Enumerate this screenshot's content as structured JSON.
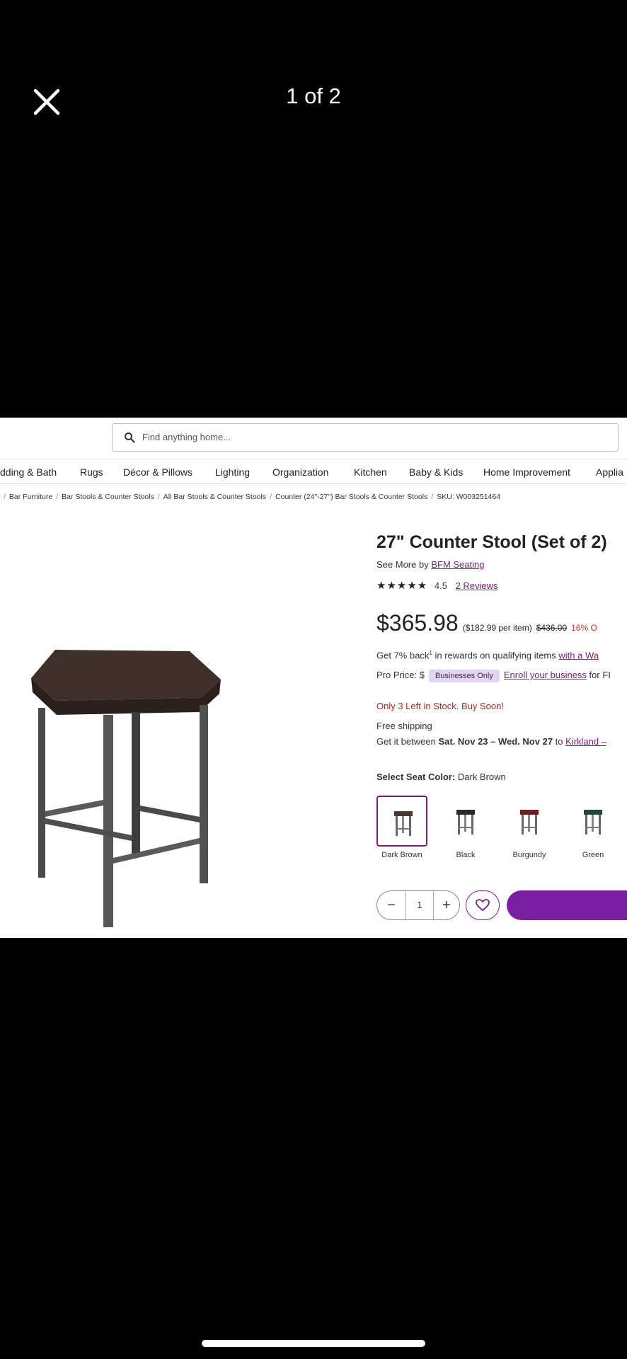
{
  "viewer": {
    "counter": "1 of 2"
  },
  "search": {
    "placeholder": "Find anything home..."
  },
  "nav": [
    "dding & Bath",
    "Rugs",
    "Décor & Pillows",
    "Lighting",
    "Organization",
    "Kitchen",
    "Baby & Kids",
    "Home Improvement",
    "Applia"
  ],
  "breadcrumb": [
    "Bar Furniture",
    "Bar Stools & Counter Stools",
    "All Bar Stools & Counter Stools",
    "Counter (24\"-27\") Bar Stools & Counter Stools",
    "SKU: W003251464"
  ],
  "product": {
    "title": "27\" Counter Stool (Set of 2)",
    "see_more_prefix": "See More by ",
    "brand": "BFM Seating",
    "rating": "4.5",
    "reviews": "2 Reviews",
    "price": "$365.98",
    "per_item": "($182.99 per item)",
    "old_price": "$436.00",
    "discount": "16% O",
    "rewards_pre": "Get 7% back",
    "rewards_sup": "1",
    "rewards_mid": " in rewards on qualifying items ",
    "rewards_link": "with a Wa",
    "pro_label": "Pro Price: $",
    "pro_badge": "Businesses Only",
    "pro_link": "Enroll your business",
    "pro_suffix": " for FI",
    "stock": "Only 3 Left in Stock. Buy Soon!",
    "shipping": "Free shipping",
    "delivery_pre": "Get it between ",
    "delivery_dates": "Sat. Nov 23 – Wed. Nov 27",
    "delivery_to": " to ",
    "delivery_link": "Kirkland –",
    "color_label": "Select Seat Color:",
    "color_value": " Dark Brown",
    "swatches": [
      {
        "label": "Dark Brown",
        "color": "#4a3a32"
      },
      {
        "label": "Black",
        "color": "#2a2a2a"
      },
      {
        "label": "Burgundy",
        "color": "#6b1f24"
      },
      {
        "label": "Green",
        "color": "#1f4a35"
      }
    ],
    "quantity": "1"
  },
  "colors": {
    "brand": "#7f187f",
    "cart": "#7b1fa2",
    "stock": "#b3261e"
  }
}
